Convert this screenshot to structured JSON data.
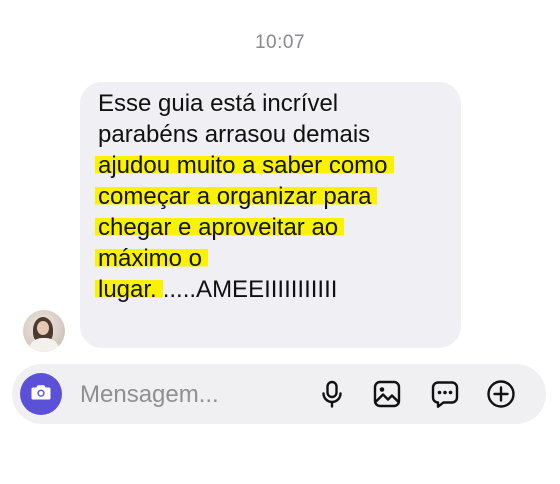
{
  "timestamp": "10:07",
  "message": {
    "lines": [
      {
        "text": "Esse guia está incrível",
        "tail": ""
      },
      {
        "text": "parabéns arrasou demais",
        "tail": ""
      },
      {
        "text": "ajudou muito a saber como",
        "tail": ""
      },
      {
        "text": "começar a organizar para",
        "tail": ""
      },
      {
        "text": "chegar e aproveitar ao",
        "tail": ""
      },
      {
        "text": "máximo o",
        "tail": ""
      },
      {
        "text": "lugar.",
        "tail": ".....AMEEIIIIIIIIIII"
      }
    ],
    "highlight_color": "#fbf200",
    "bubble_color": "#efeff4"
  },
  "composer": {
    "placeholder": "Mensagem...",
    "accent_color": "#5b51d8",
    "icons": [
      "camera-icon",
      "microphone-icon",
      "image-icon",
      "sticker-icon",
      "plus-icon"
    ]
  }
}
